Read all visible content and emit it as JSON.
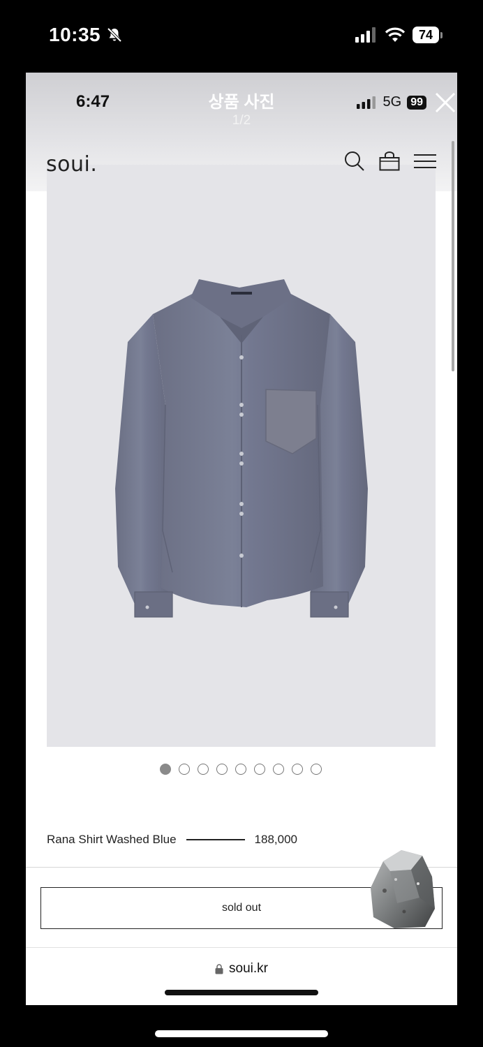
{
  "outer_status": {
    "time": "10:35",
    "battery": "74"
  },
  "inner_status": {
    "time": "6:47",
    "network": "5G",
    "battery": "99"
  },
  "viewer": {
    "title": "상품 사진",
    "counter": "1/2"
  },
  "site": {
    "brand": "soui.",
    "url": "soui.kr"
  },
  "gallery": {
    "total_dots": 9,
    "active_index": 0
  },
  "product": {
    "name": "Rana Shirt Washed Blue",
    "price": "188,000",
    "button_label": "sold out"
  },
  "icons": [
    "bell-slash-icon",
    "signal-icon",
    "wifi-icon",
    "battery-icon",
    "close-icon",
    "search-icon",
    "bag-icon",
    "menu-icon",
    "lock-icon"
  ],
  "colors": {
    "photo_bg": "#e4e4e8",
    "shirt": "#6f7488",
    "text": "#222222"
  }
}
